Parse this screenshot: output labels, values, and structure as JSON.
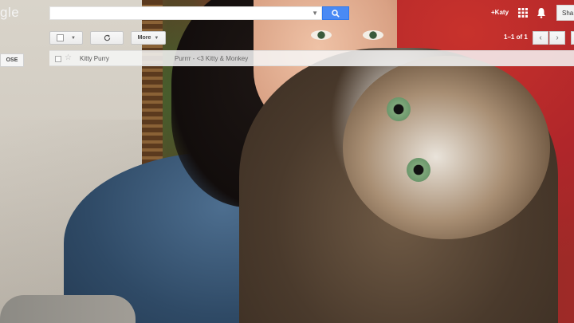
{
  "header": {
    "logo_text": "gle",
    "search_value": "",
    "user_name": "+Katy",
    "share_label": "Sha"
  },
  "toolbar": {
    "more_label": "More",
    "pager_text": "1–1 of 1"
  },
  "sidebar": {
    "compose_label": "OSE"
  },
  "messages": [
    {
      "sender": "Kitty Purry",
      "subject": "Purrrr - <3 Kitty & Monkey"
    }
  ],
  "colors": {
    "search_button": "#4a8af4",
    "row_background": "#f6f6f6"
  },
  "icons": [
    "search-icon",
    "dropdown-caret-icon",
    "apps-grid-icon",
    "bell-icon",
    "refresh-icon",
    "star-icon",
    "chevron-left-icon",
    "chevron-right-icon"
  ]
}
